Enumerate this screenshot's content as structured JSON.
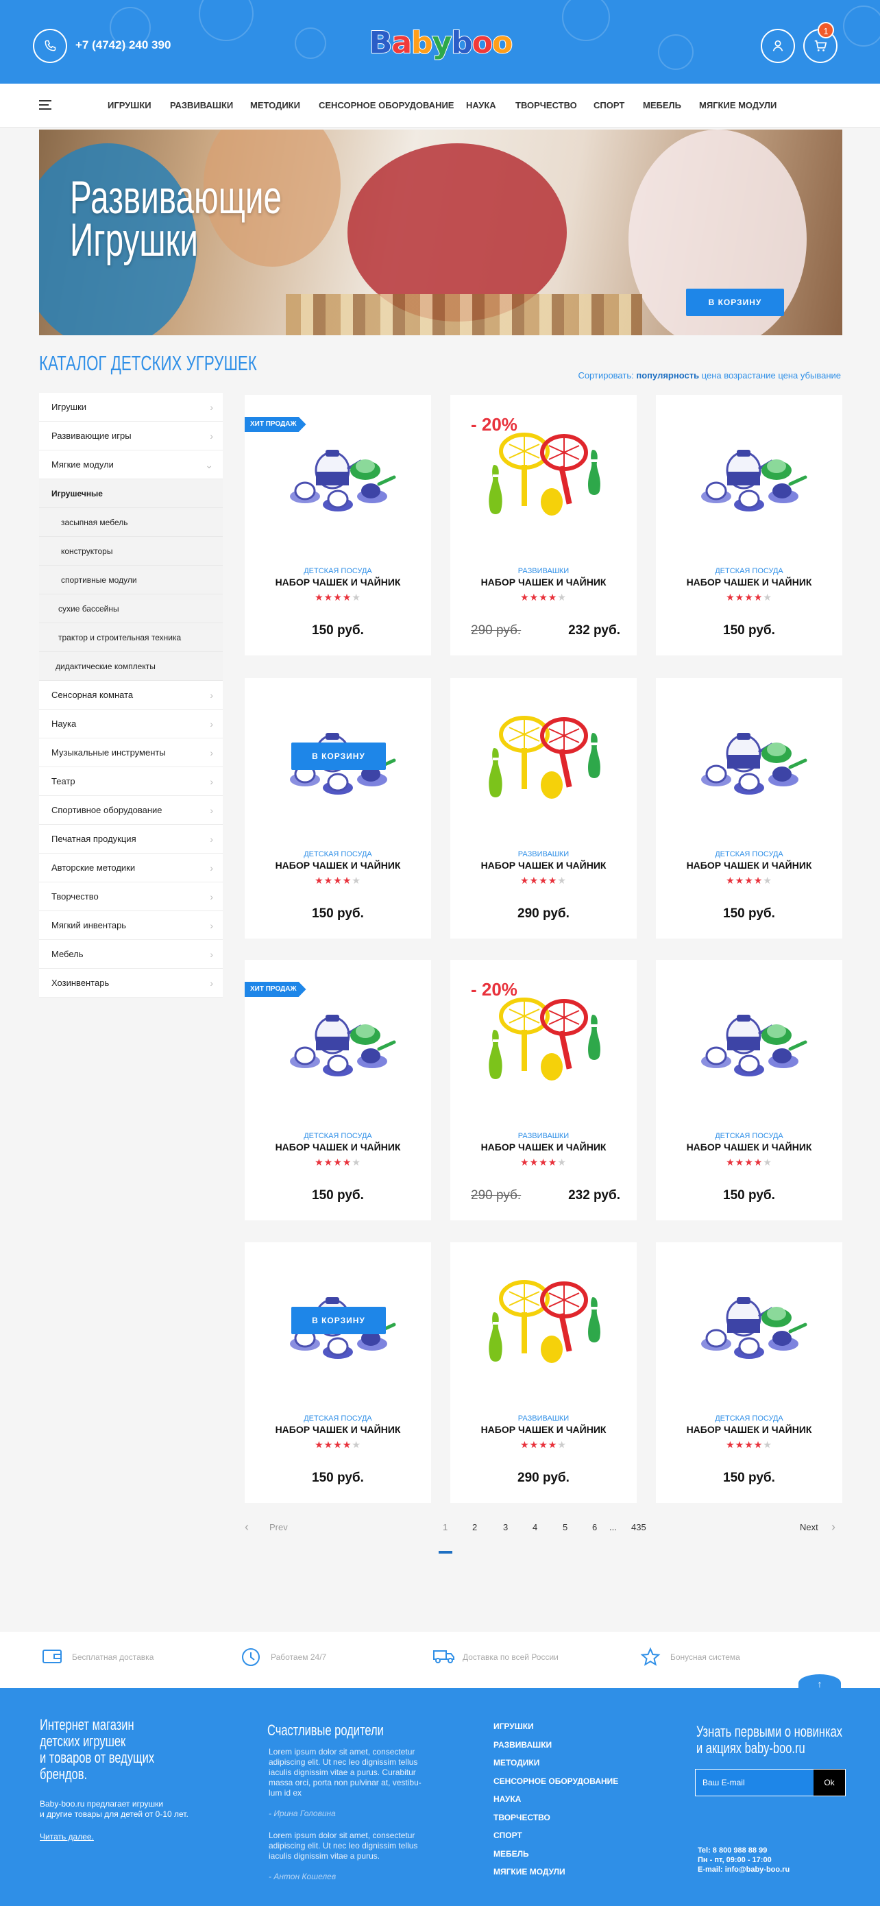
{
  "header": {
    "phone": "+7 (4742) 240 390",
    "logo": [
      "B",
      "a",
      "b",
      "y",
      "b",
      "o",
      "o"
    ],
    "logo_colors": [
      "#2b5ec7",
      "#f03a3a",
      "#ff9e1b",
      "#2ea84a",
      "#2b5ec7",
      "#f03a3a",
      "#ff9e1b"
    ],
    "cart_count": "1"
  },
  "nav": {
    "items": [
      "ИГРУШКИ",
      "РАЗВИВАШКИ",
      "МЕТОДИКИ",
      "СЕНСОРНОЕ ОБОРУДОВАНИЕ",
      "НАУКА",
      "ТВОРЧЕСТВО",
      "СПОРТ",
      "МЕБЕЛЬ",
      "МЯГКИЕ МОДУЛИ"
    ]
  },
  "hero": {
    "title_line1": "Развивающие",
    "title_line2": "Игрушки",
    "button": "В КОРЗИНУ"
  },
  "catalog": {
    "title": "КАТАЛОГ ДЕТСКИХ УГРУШЕК",
    "sort_label": "Сортировать:",
    "sort_active": "популярность",
    "sort_up": "цена возрастание",
    "sort_down": "цена убывание"
  },
  "sidebar": {
    "top": [
      "Игрушки",
      "Развивающие игры",
      "Мягкие модули"
    ],
    "sub_head": "Игрушечные",
    "subs": [
      "засыпная мебель",
      "конструкторы",
      "спортивные модули",
      "сухие бассейны",
      "трактор и строительная техника",
      "дидактические комплекты"
    ],
    "bottom": [
      "Сенсорная комната",
      "Наука",
      "Музыкальные инструменты",
      "Театр",
      "Спортивное оборудование",
      "Печатная продукция",
      "Авторские методики",
      "Творчество",
      "Мягкий инвентарь",
      "Мебель",
      "Хозинвентарь"
    ]
  },
  "product_labels": {
    "hit": "ХИТ ПРОДАЖ",
    "discount": "- 20%",
    "to_cart": "В КОРЗИНУ",
    "name": "НАБОР ЧАШЕК И ЧАЙНИК",
    "cat_dishes": "ДЕТСКАЯ ПОСУДА",
    "cat_dev": "РАЗВИВАШКИ",
    "price_150": "150 руб.",
    "price_290": "290 руб.",
    "price_old": "290 руб.",
    "price_new": "232 руб."
  },
  "rating": {
    "value": 4,
    "max": 5
  },
  "pager": {
    "prev": "Prev",
    "next": "Next",
    "pages": [
      "1",
      "2",
      "3",
      "4",
      "5",
      "6",
      "...",
      "435"
    ],
    "current": "1"
  },
  "benefits": [
    "Бесплатная доставка",
    "Работаем 24/7",
    "Доставка по всей России",
    "Бонусная система"
  ],
  "footer": {
    "about_title": [
      "Интернет магазин",
      "детских игрушек",
      "и товаров от ведущих",
      "брендов."
    ],
    "about_text": [
      "Baby-boo.ru предлагает игрушки",
      "и другие товары для детей от 0-10 лет."
    ],
    "about_link": "Читать далее.",
    "parents_title": "Счастливые родители",
    "review1": [
      "Lorem ipsum dolor sit amet, consectetur",
      "adipiscing elit. Ut nec leo dignissim tellus",
      "iaculis dignissim vitae a purus. Curabitur",
      "massa orci, porta non pulvinar at, vestibu-",
      "lum id ex"
    ],
    "author1": "- Ирина Головина",
    "review2": [
      "Lorem ipsum dolor sit amet, consectetur",
      "adipiscing elit. Ut nec leo dignissim tellus",
      "iaculis dignissim vitae a purus."
    ],
    "author2": "- Антон Кошелев",
    "links": [
      "ИГРУШКИ",
      "РАЗВИВАШКИ",
      "МЕТОДИКИ",
      "СЕНСОРНОЕ ОБОРУДОВАНИЕ",
      "НАУКА",
      "ТВОРЧЕСТВО",
      "СПОРТ",
      "МЕБЕЛЬ",
      "МЯГКИЕ МОДУЛИ"
    ],
    "news_title": [
      "Узнать первыми о новинках",
      "и акциях baby-boo.ru"
    ],
    "email_placeholder": "Ваш E-mail",
    "ok": "Ok",
    "contacts": [
      "Tel: 8 800 988 88 99",
      "Пн - пт, 09:00 - 17:00",
      "E-mail: info@baby-boo.ru"
    ]
  }
}
